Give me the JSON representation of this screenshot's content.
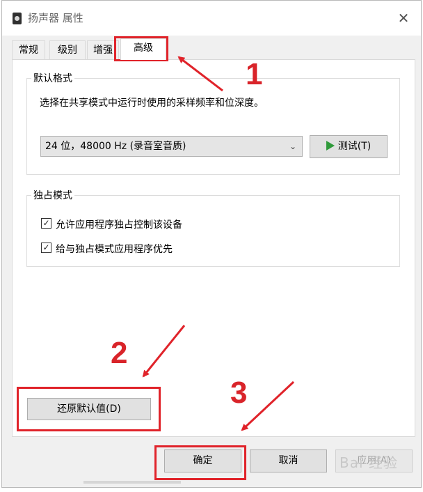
{
  "window": {
    "title": "扬声器 属性",
    "close_glyph": "✕"
  },
  "tabs": [
    {
      "label": "常规"
    },
    {
      "label": "级别"
    },
    {
      "label": "增强"
    },
    {
      "label": "高级"
    }
  ],
  "default_format": {
    "group_label": "默认格式",
    "description": "选择在共享模式中运行时使用的采样频率和位深度。",
    "selected": "24 位，48000 Hz (录音室音质)",
    "test_button": "测试(T)"
  },
  "exclusive_mode": {
    "group_label": "独占模式",
    "options": [
      {
        "label": "允许应用程序独占控制该设备",
        "checked": true
      },
      {
        "label": "给与独占模式应用程序优先",
        "checked": true
      }
    ]
  },
  "restore_button": "还原默认值(D)",
  "footer": {
    "ok": "确定",
    "cancel": "取消",
    "apply": "应用(A)"
  },
  "annotations": {
    "n1": "1",
    "n2": "2",
    "n3": "3",
    "color": "#e0232a"
  },
  "watermark": "Bai 经验",
  "icons": {
    "play": "play-icon",
    "close": "close-icon",
    "dropdown": "chevron-down-icon",
    "check": "checkmark-icon"
  }
}
